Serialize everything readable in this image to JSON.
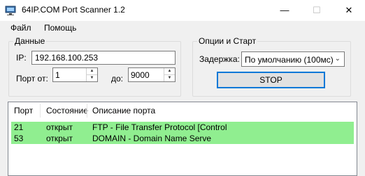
{
  "window": {
    "title": "64IP.COM Port Scanner 1.2",
    "icon": "network-icon",
    "controls": {
      "minimize": "—",
      "maximize": "☐",
      "close": "✕"
    }
  },
  "menu": {
    "file": "Файл",
    "help": "Помощь"
  },
  "data_group": {
    "legend": "Данные",
    "ip_label": "IP:",
    "ip_value": "192.168.100.253",
    "port_from_label": "Порт от:",
    "port_from_value": "1",
    "port_to_label": "до:",
    "port_to_value": "9000"
  },
  "options_group": {
    "legend": "Опции и Старт",
    "delay_label": "Задержка:",
    "delay_value": "По умолчанию (100мс)",
    "stop_label": "STOP"
  },
  "results": {
    "headers": [
      "Порт",
      "Состояние",
      "Описание порта"
    ],
    "rows": [
      {
        "port": "21",
        "state": "открыт",
        "desc": "FTP - File Transfer Protocol [Control"
      },
      {
        "port": "53",
        "state": "открыт",
        "desc": "DOMAIN - Domain Name Serve"
      }
    ],
    "row_color": "#90ee90"
  }
}
